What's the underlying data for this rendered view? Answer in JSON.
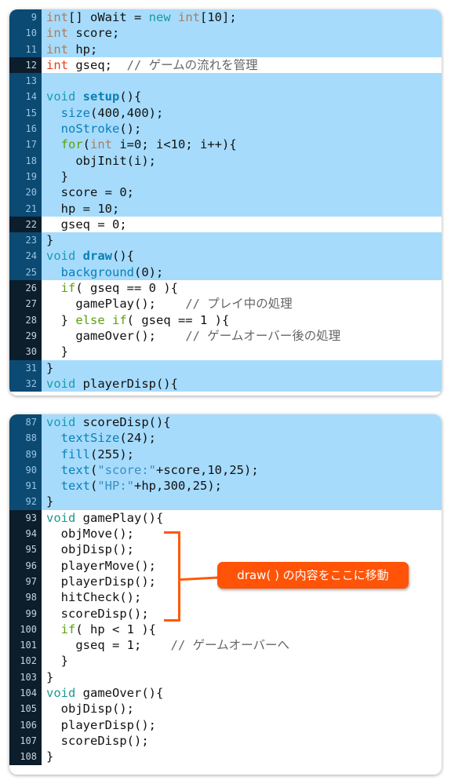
{
  "panel1": {
    "lines": [
      {
        "n": "9",
        "hl": true,
        "tokens": [
          [
            "kw-type",
            "int"
          ],
          [
            "",
            "[] oWait = "
          ],
          [
            "kw-new",
            "new"
          ],
          [
            "",
            " "
          ],
          [
            "kw-type",
            "int"
          ],
          [
            "",
            "[10];"
          ]
        ]
      },
      {
        "n": "10",
        "hl": true,
        "tokens": [
          [
            "kw-type",
            "int"
          ],
          [
            "",
            " score;"
          ]
        ]
      },
      {
        "n": "11",
        "hl": true,
        "tokens": [
          [
            "kw-type",
            "int"
          ],
          [
            "",
            " hp;"
          ]
        ]
      },
      {
        "n": "12",
        "hl": false,
        "tokens": [
          [
            "kw-red",
            "int"
          ],
          [
            "",
            " gseq;  "
          ],
          [
            "cm",
            "// ゲームの流れを管理"
          ]
        ]
      },
      {
        "n": "13",
        "hl": true,
        "tokens": []
      },
      {
        "n": "14",
        "hl": true,
        "tokens": [
          [
            "kw-void",
            "void"
          ],
          [
            "",
            " "
          ],
          [
            "kw-fn",
            "setup"
          ],
          [
            "",
            "(){"
          ]
        ]
      },
      {
        "n": "15",
        "hl": true,
        "tokens": [
          [
            "",
            "  "
          ],
          [
            "kw-call",
            "size"
          ],
          [
            "",
            "(400,400);"
          ]
        ]
      },
      {
        "n": "16",
        "hl": true,
        "tokens": [
          [
            "",
            "  "
          ],
          [
            "kw-call",
            "noStroke"
          ],
          [
            "",
            "();"
          ]
        ]
      },
      {
        "n": "17",
        "hl": true,
        "tokens": [
          [
            "",
            "  "
          ],
          [
            "kw-ctrl",
            "for"
          ],
          [
            "",
            "("
          ],
          [
            "kw-type",
            "int"
          ],
          [
            "",
            " i=0; i<10; i++){"
          ]
        ]
      },
      {
        "n": "18",
        "hl": true,
        "tokens": [
          [
            "",
            "    objInit(i);"
          ]
        ]
      },
      {
        "n": "19",
        "hl": true,
        "tokens": [
          [
            "",
            "  }"
          ]
        ]
      },
      {
        "n": "20",
        "hl": true,
        "tokens": [
          [
            "",
            "  score = 0;"
          ]
        ]
      },
      {
        "n": "21",
        "hl": true,
        "tokens": [
          [
            "",
            "  hp = 10;"
          ]
        ]
      },
      {
        "n": "22",
        "hl": false,
        "tokens": [
          [
            "",
            "  gseq = 0;"
          ]
        ]
      },
      {
        "n": "23",
        "hl": true,
        "tokens": [
          [
            "",
            "}"
          ]
        ]
      },
      {
        "n": "24",
        "hl": true,
        "tokens": [
          [
            "kw-void",
            "void"
          ],
          [
            "",
            " "
          ],
          [
            "kw-fn",
            "draw"
          ],
          [
            "",
            "(){"
          ]
        ]
      },
      {
        "n": "25",
        "hl": true,
        "tokens": [
          [
            "",
            "  "
          ],
          [
            "kw-call",
            "background"
          ],
          [
            "",
            "(0);"
          ]
        ]
      },
      {
        "n": "26",
        "hl": false,
        "tokens": [
          [
            "",
            "  "
          ],
          [
            "kw-ctrl",
            "if"
          ],
          [
            "",
            "( gseq == 0 ){"
          ]
        ]
      },
      {
        "n": "27",
        "hl": false,
        "tokens": [
          [
            "",
            "    gamePlay();    "
          ],
          [
            "cm",
            "// プレイ中の処理"
          ]
        ]
      },
      {
        "n": "28",
        "hl": false,
        "tokens": [
          [
            "",
            "  } "
          ],
          [
            "kw-ctrl",
            "else if"
          ],
          [
            "",
            "( gseq == 1 ){"
          ]
        ]
      },
      {
        "n": "29",
        "hl": false,
        "tokens": [
          [
            "",
            "    gameOver();    "
          ],
          [
            "cm",
            "// ゲームオーバー後の処理"
          ]
        ]
      },
      {
        "n": "30",
        "hl": false,
        "tokens": [
          [
            "",
            "  }"
          ]
        ]
      },
      {
        "n": "31",
        "hl": true,
        "tokens": [
          [
            "",
            "}"
          ]
        ]
      },
      {
        "n": "32",
        "hl": true,
        "tokens": [
          [
            "kw-void",
            "void"
          ],
          [
            "",
            " playerDisp(){"
          ]
        ]
      }
    ]
  },
  "panel2": {
    "lines": [
      {
        "n": "87",
        "hl": true,
        "tokens": [
          [
            "kw-void",
            "void"
          ],
          [
            "",
            " scoreDisp(){"
          ]
        ]
      },
      {
        "n": "88",
        "hl": true,
        "tokens": [
          [
            "",
            "  "
          ],
          [
            "kw-call",
            "textSize"
          ],
          [
            "",
            "(24);"
          ]
        ]
      },
      {
        "n": "89",
        "hl": true,
        "tokens": [
          [
            "",
            "  "
          ],
          [
            "kw-call",
            "fill"
          ],
          [
            "",
            "(255);"
          ]
        ]
      },
      {
        "n": "90",
        "hl": true,
        "tokens": [
          [
            "",
            "  "
          ],
          [
            "kw-call",
            "text"
          ],
          [
            "",
            "("
          ],
          [
            "kw-str",
            "\"score:\""
          ],
          [
            "",
            "+score,10,25);"
          ]
        ]
      },
      {
        "n": "91",
        "hl": true,
        "tokens": [
          [
            "",
            "  "
          ],
          [
            "kw-call",
            "text"
          ],
          [
            "",
            "("
          ],
          [
            "kw-str",
            "\"HP:\""
          ],
          [
            "",
            "+hp,300,25);"
          ]
        ]
      },
      {
        "n": "92",
        "hl": true,
        "tokens": [
          [
            "",
            "}"
          ]
        ]
      },
      {
        "n": "93",
        "hl": false,
        "tokens": [
          [
            "void-teal",
            "void"
          ],
          [
            "",
            " gamePlay(){"
          ]
        ]
      },
      {
        "n": "94",
        "hl": false,
        "tokens": [
          [
            "",
            "  objMove();"
          ]
        ]
      },
      {
        "n": "95",
        "hl": false,
        "tokens": [
          [
            "",
            "  objDisp();"
          ]
        ]
      },
      {
        "n": "96",
        "hl": false,
        "tokens": [
          [
            "",
            "  playerMove();"
          ]
        ]
      },
      {
        "n": "97",
        "hl": false,
        "tokens": [
          [
            "",
            "  playerDisp();"
          ]
        ]
      },
      {
        "n": "98",
        "hl": false,
        "tokens": [
          [
            "",
            "  hitCheck();"
          ]
        ]
      },
      {
        "n": "99",
        "hl": false,
        "tokens": [
          [
            "",
            "  scoreDisp();"
          ]
        ]
      },
      {
        "n": "100",
        "hl": false,
        "tokens": [
          [
            "",
            "  "
          ],
          [
            "kw-ctrl",
            "if"
          ],
          [
            "",
            "( hp < 1 ){"
          ]
        ]
      },
      {
        "n": "101",
        "hl": false,
        "tokens": [
          [
            "",
            "    gseq = 1;    "
          ],
          [
            "cm",
            "// ゲームオーバーへ"
          ]
        ]
      },
      {
        "n": "102",
        "hl": false,
        "tokens": [
          [
            "",
            "  }"
          ]
        ]
      },
      {
        "n": "103",
        "hl": false,
        "tokens": [
          [
            "",
            "}"
          ]
        ]
      },
      {
        "n": "104",
        "hl": false,
        "tokens": [
          [
            "void-teal",
            "void"
          ],
          [
            "",
            " gameOver(){"
          ]
        ]
      },
      {
        "n": "105",
        "hl": false,
        "tokens": [
          [
            "",
            "  objDisp();"
          ]
        ]
      },
      {
        "n": "106",
        "hl": false,
        "tokens": [
          [
            "",
            "  playerDisp();"
          ]
        ]
      },
      {
        "n": "107",
        "hl": false,
        "tokens": [
          [
            "",
            "  scoreDisp();"
          ]
        ]
      },
      {
        "n": "108",
        "hl": false,
        "tokens": [
          [
            "",
            "}"
          ]
        ]
      }
    ]
  },
  "annotation": {
    "callout_text": "draw( ) の内容をここに移動",
    "color": "#ff5307"
  },
  "colors": {
    "highlight_bg": "#a6dbfc",
    "gutter_highlight": "#0b4a73",
    "gutter_plain": "#0c1d2b"
  }
}
